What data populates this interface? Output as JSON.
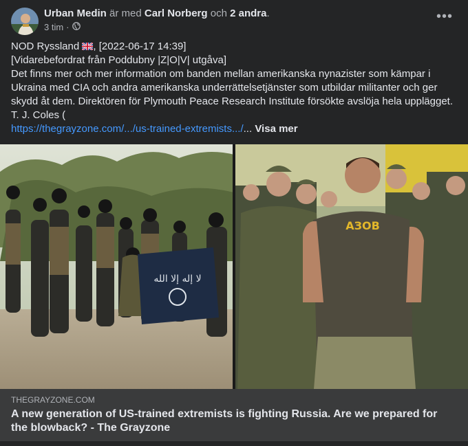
{
  "post": {
    "author": "Urban Medin",
    "with_text": "är med",
    "tagged_person": "Carl Norberg",
    "and_text": "och",
    "others": "2 andra",
    "period": ".",
    "time": "3 tim",
    "separator": "·",
    "privacy_icon": "globe-icon",
    "more_icon": "ellipsis-icon"
  },
  "body": {
    "line1_prefix": "NOD Ryssland",
    "flag_icon": "uk-flag-icon",
    "line1_suffix": ", [2022-06-17 14:39]",
    "line2": "[Vidarebefordrat från Poddubny |Z|O|V| utgåva]",
    "paragraph": "Det finns mer och mer information om banden mellan amerikanska nynazister som kämpar i Ukraina med CIA och andra amerikanska underrättelsetjänster som utbildar militanter och ger skydd åt dem. Direktören för Plymouth Peace Research Institute försökte avslöja hela upplägget.",
    "line_author": "T. J. Coles (",
    "link_text": "https://thegrayzone.com/.../us-trained-extremists.../",
    "ellipsis": "...",
    "see_more": "Visa mer"
  },
  "image": {
    "flag_text": "ﻻ إله إلا الله",
    "shirt_text": "АЗОВ"
  },
  "preview": {
    "domain": "THEGRAYZONE.COM",
    "title": "A new generation of US-trained extremists is fighting Russia. Are we prepared for the blowback? - The Grayzone"
  },
  "colors": {
    "background": "#242526",
    "preview_bg": "#3a3b3c",
    "link": "#4599ff",
    "text": "#e4e6eb",
    "secondary": "#b0b3b8"
  }
}
